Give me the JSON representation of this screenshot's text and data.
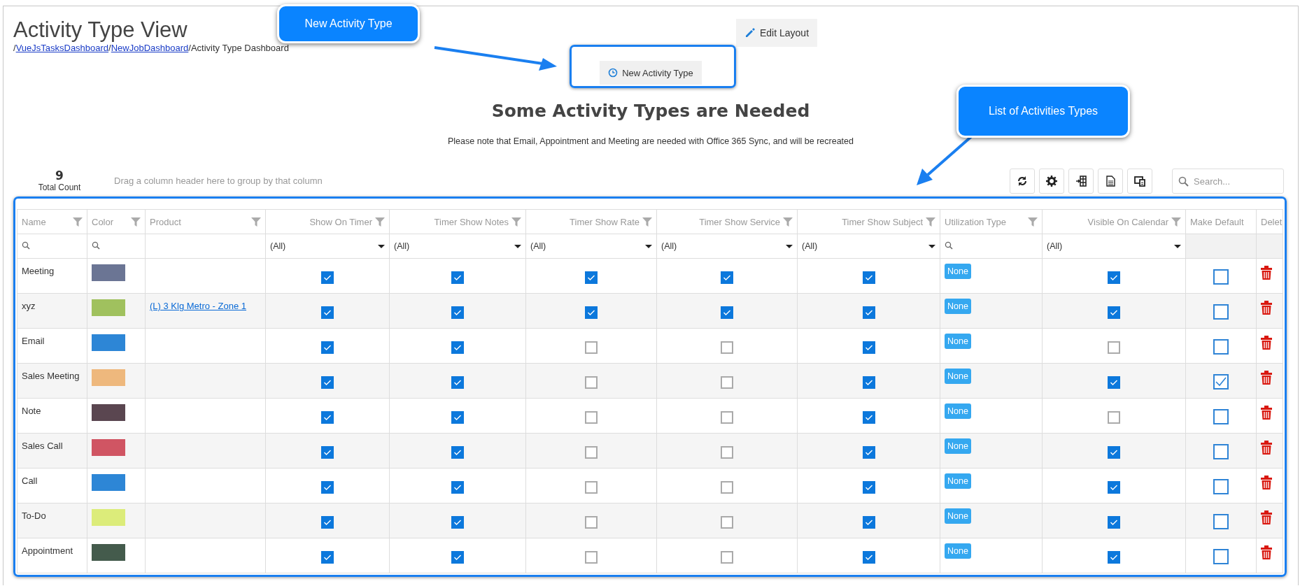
{
  "header": {
    "title": "Activity Type View",
    "breadcrumb": [
      {
        "text": "/",
        "kind": "sep"
      },
      {
        "text": "VueJsTasksDashboard",
        "kind": "link"
      },
      {
        "text": "/",
        "kind": "sep"
      },
      {
        "text": "NewJobDashboard",
        "kind": "link"
      },
      {
        "text": "/Activity Type Dashboard",
        "kind": "current"
      }
    ],
    "edit_layout_button": "Edit Layout"
  },
  "new_button": "New Activity Type",
  "heading": "Some Activity Types are Needed",
  "note": "Please note that Email, Appointment and Meeting are needed with Office 365 Sync, and will be recreated",
  "toolbar": {
    "count": "9",
    "count_label": "Total Count",
    "group_hint": "Drag a column header here to group by that column",
    "search": {
      "placeholder": "Search..."
    }
  },
  "table": {
    "columns": [
      {
        "label": "Name",
        "kind": "text",
        "filter": {
          "kind": "search"
        },
        "filterable": true
      },
      {
        "label": "Color",
        "kind": "swatch",
        "filter": {
          "kind": "search"
        },
        "filterable": true
      },
      {
        "label": "Product",
        "kind": "link",
        "filter": {
          "kind": "blank"
        },
        "filterable": true
      },
      {
        "label": "Show On Timer",
        "kind": "check",
        "filter": {
          "kind": "select",
          "value": "(All)"
        },
        "filterable": true
      },
      {
        "label": "Timer Show Notes",
        "kind": "check",
        "filter": {
          "kind": "select",
          "value": "(All)"
        },
        "filterable": true
      },
      {
        "label": "Timer Show Rate",
        "kind": "check",
        "filter": {
          "kind": "select",
          "value": "(All)"
        },
        "filterable": true
      },
      {
        "label": "Timer Show Service",
        "kind": "check",
        "filter": {
          "kind": "select",
          "value": "(All)"
        },
        "filterable": true
      },
      {
        "label": "Timer Show Subject",
        "kind": "check",
        "filter": {
          "kind": "select",
          "value": "(All)"
        },
        "filterable": true
      },
      {
        "label": "Utilization Type",
        "kind": "badge",
        "filter": {
          "kind": "search"
        },
        "filterable": true
      },
      {
        "label": "Visible On Calendar",
        "kind": "check",
        "filter": {
          "kind": "select",
          "value": "(All)"
        },
        "filterable": true
      },
      {
        "label": "Make Default",
        "kind": "default",
        "filter": {
          "kind": "none"
        },
        "filterable": false
      },
      {
        "label": "Delet",
        "kind": "delete",
        "filter": {
          "kind": "none"
        },
        "filterable": false
      }
    ],
    "rows": [
      {
        "name": "Meeting",
        "color": "#6b7594",
        "show_on_timer": true,
        "timer_show_notes": true,
        "timer_show_rate": true,
        "timer_show_service": true,
        "timer_show_subject": true,
        "utilization_type": "None",
        "visible_on_calendar": true,
        "make_default": false
      },
      {
        "name": "xyz",
        "color": "#a0c15e",
        "product": "(L) 3 Klg Metro - Zone 1",
        "show_on_timer": true,
        "timer_show_notes": true,
        "timer_show_rate": true,
        "timer_show_service": true,
        "timer_show_subject": true,
        "utilization_type": "None",
        "visible_on_calendar": true,
        "make_default": false
      },
      {
        "name": "Email",
        "color": "#2d86d6",
        "show_on_timer": true,
        "timer_show_notes": true,
        "timer_show_rate": false,
        "timer_show_service": false,
        "timer_show_subject": true,
        "utilization_type": "None",
        "visible_on_calendar": false,
        "make_default": false
      },
      {
        "name": "Sales Meeting",
        "color": "#eeb87d",
        "show_on_timer": true,
        "timer_show_notes": true,
        "timer_show_rate": false,
        "timer_show_service": false,
        "timer_show_subject": true,
        "utilization_type": "None",
        "visible_on_calendar": true,
        "make_default": true
      },
      {
        "name": "Note",
        "color": "#5a4650",
        "show_on_timer": true,
        "timer_show_notes": true,
        "timer_show_rate": false,
        "timer_show_service": false,
        "timer_show_subject": true,
        "utilization_type": "None",
        "visible_on_calendar": false,
        "make_default": false
      },
      {
        "name": "Sales Call",
        "color": "#d05563",
        "show_on_timer": true,
        "timer_show_notes": true,
        "timer_show_rate": false,
        "timer_show_service": false,
        "timer_show_subject": true,
        "utilization_type": "None",
        "visible_on_calendar": true,
        "make_default": false
      },
      {
        "name": "Call",
        "color": "#2d86d6",
        "show_on_timer": true,
        "timer_show_notes": true,
        "timer_show_rate": false,
        "timer_show_service": false,
        "timer_show_subject": true,
        "utilization_type": "None",
        "visible_on_calendar": true,
        "make_default": false
      },
      {
        "name": "To-Do",
        "color": "#dcec7a",
        "show_on_timer": true,
        "timer_show_notes": true,
        "timer_show_rate": false,
        "timer_show_service": false,
        "timer_show_subject": true,
        "utilization_type": "None",
        "visible_on_calendar": true,
        "make_default": false
      },
      {
        "name": "Appointment",
        "color": "#445b4c",
        "show_on_timer": true,
        "timer_show_notes": true,
        "timer_show_rate": false,
        "timer_show_service": false,
        "timer_show_subject": true,
        "utilization_type": "None",
        "visible_on_calendar": true,
        "make_default": false
      }
    ]
  },
  "callouts": [
    {
      "text": "New Activity Type"
    },
    {
      "text": "List of Activities Types"
    }
  ]
}
